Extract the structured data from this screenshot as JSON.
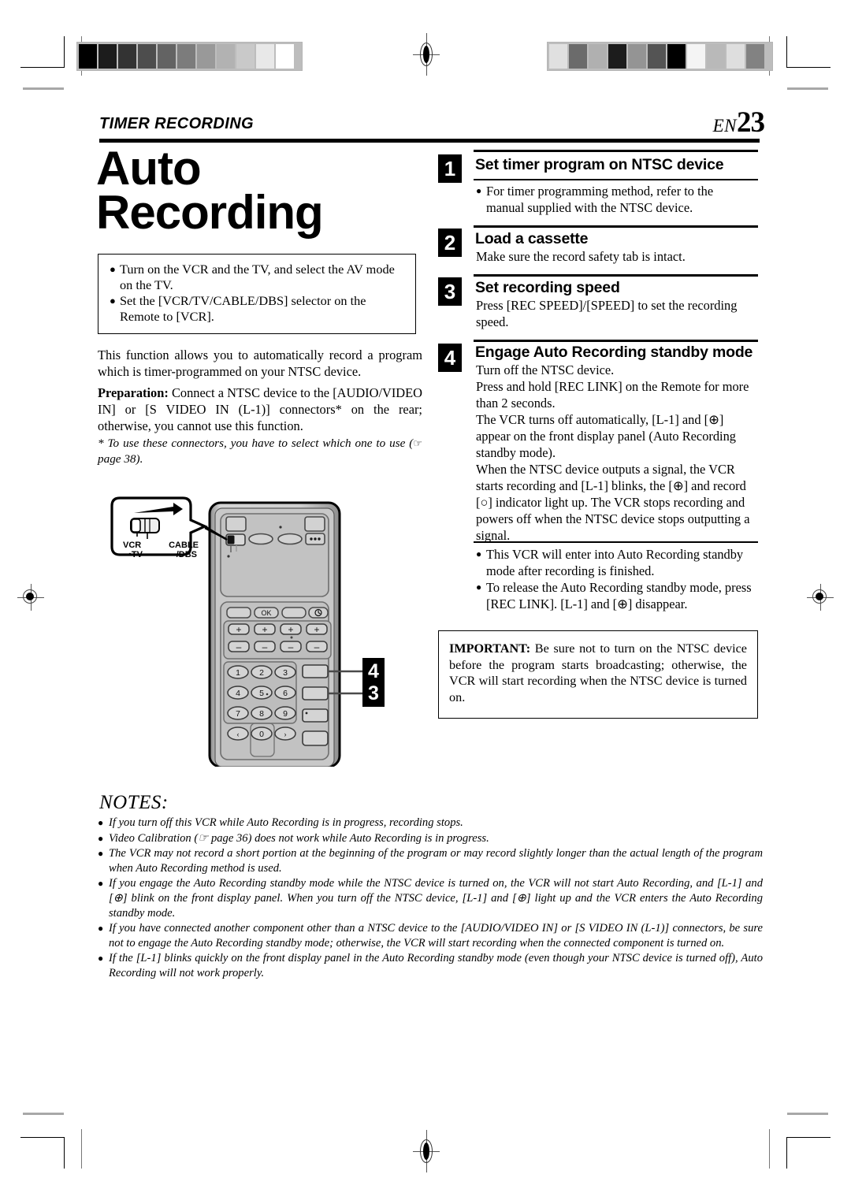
{
  "header": {
    "section_title": "TIMER RECORDING",
    "lang_code": "EN",
    "page_number": "23"
  },
  "left_column": {
    "title_line1": "Auto",
    "title_line2": "Recording",
    "prep_box": {
      "bullets": [
        "Turn on the VCR and the TV, and select the AV mode on the TV.",
        "Set the [VCR/TV/CABLE/DBS] selector on the Remote to [VCR]."
      ]
    },
    "intro_paragraph": "This function allows you to automatically record a program which is timer-programmed on your NTSC device.",
    "preparation_label": "Preparation:",
    "preparation_text": " Connect a NTSC device to the [AUDIO/VIDEO IN] or [S VIDEO IN (L-1)] connectors* on the rear; otherwise, you cannot use this function.",
    "footnote": "* To use these connectors, you have to select which one to use (",
    "footnote_end": " page 38)."
  },
  "steps": [
    {
      "number": "1",
      "heading": "Set timer program on NTSC device",
      "bullets": [
        "For timer programming method, refer to the manual supplied with the NTSC device."
      ],
      "lines": []
    },
    {
      "number": "2",
      "heading": "Load a cassette",
      "bullets": [],
      "lines": [
        "Make sure the record safety tab is intact."
      ]
    },
    {
      "number": "3",
      "heading": "Set recording speed",
      "bullets": [],
      "lines": [
        "Press [REC SPEED]/[SPEED] to set the recording speed."
      ]
    },
    {
      "number": "4",
      "heading": "Engage Auto Recording standby mode",
      "bullets": [],
      "lines": [
        "Turn off the NTSC device.",
        "Press and hold [REC LINK] on the Remote for more than 2 seconds.",
        "The VCR turns off automatically, [L-1] and [⊕] appear on the front display panel (Auto Recording standby mode).",
        "When the NTSC device outputs a signal, the VCR starts recording and [L-1] blinks, the [⊕] and record [○] indicator light up. The VCR stops recording and powers off when the NTSC device stops outputting a signal."
      ]
    }
  ],
  "step4_notes": [
    "This VCR will enter into Auto Recording standby mode after recording is finished.",
    "To release the Auto Recording standby mode, press [REC LINK]. [L-1] and [⊕] disappear."
  ],
  "important_box": {
    "label": "IMPORTANT:",
    "text": " Be sure not to turn on the NTSC device before the program starts broadcasting; otherwise, the VCR will start recording when the NTSC device is turned on."
  },
  "notes": {
    "title": "NOTES:",
    "items": [
      "If you turn off this VCR while Auto Recording is in progress, recording stops.",
      "Video Calibration (☞ page 36) does not work while Auto Recording is in progress.",
      "The VCR may not record a short portion at the beginning of the program or may record slightly longer than the actual length of the program when Auto Recording method is used.",
      "If you engage the Auto Recording standby mode while the NTSC device is turned on, the VCR will not start Auto Recording, and [L-1] and [⊕] blink on the front display panel. When you turn off  the NTSC device, [L-1] and [⊕] light up and the VCR enters the Auto Recording standby mode.",
      "If you have connected another component other than a NTSC device to the [AUDIO/VIDEO IN] or [S VIDEO IN (L-1)] connectors, be sure not to engage the Auto Recording standby mode; otherwise, the VCR will start recording when the connected component is turned on.",
      "If the [L-1] blinks quickly on the front display panel in the Auto Recording standby mode (even though your NTSC device is turned off), Auto Recording will not work properly."
    ]
  },
  "remote_illustration": {
    "callout_labels": {
      "vcr": "VCR",
      "tv": "•TV",
      "cable": "CABLE",
      "dbs": "/DBS"
    },
    "ok_button": "OK",
    "timer_button": "⊕",
    "plus_label": "+",
    "minus_label": "−",
    "keypad": [
      "1",
      "2",
      "3",
      "4",
      "5ₒ",
      "6",
      "7",
      "8",
      "9",
      "‹",
      "0",
      "›"
    ],
    "callout_3": "3",
    "callout_4": "4",
    "menu_dots": "●●●"
  },
  "print_marks": {
    "gray_strip_left": [
      "#000000",
      "#1c1c1c",
      "#333333",
      "#4d4d4d",
      "#636363",
      "#7c7c7c",
      "#999999",
      "#b2b2b2",
      "#c9c9c9",
      "#e8e8e8",
      "#ffffff"
    ],
    "gray_strip_right": [
      "#e0e0e0",
      "#6b6b6b",
      "#b0b0b0",
      "#1c1c1c",
      "#949494",
      "#545454",
      "#000000",
      "#f4f4f4",
      "#b9b9b9",
      "#dedede",
      "#828282"
    ]
  }
}
